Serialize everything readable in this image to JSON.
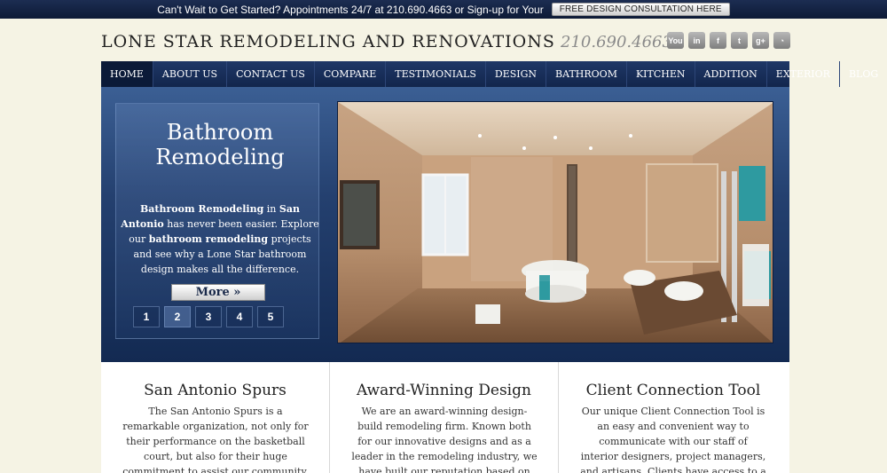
{
  "topbar": {
    "text": "Can't Wait to Get Started? Appointments 24/7 at 210.690.4663 or Sign-up for Your",
    "cta": "FREE DESIGN CONSULTATION HERE"
  },
  "header": {
    "brand": "LONE STAR REMODELING AND RENOVATIONS",
    "phone": "210.690.4663",
    "social": [
      {
        "name": "youtube-icon",
        "glyph": "You"
      },
      {
        "name": "linkedin-icon",
        "glyph": "in"
      },
      {
        "name": "facebook-icon",
        "glyph": "f"
      },
      {
        "name": "twitter-icon",
        "glyph": "t"
      },
      {
        "name": "googleplus-icon",
        "glyph": "g+"
      },
      {
        "name": "rss-icon",
        "glyph": "◔"
      }
    ]
  },
  "nav": {
    "items": [
      "HOME",
      "ABOUT US",
      "CONTACT US",
      "COMPARE",
      "TESTIMONIALS",
      "DESIGN",
      "BATHROOM",
      "KITCHEN",
      "ADDITION",
      "EXTERIOR",
      "BLOG"
    ],
    "active": "HOME"
  },
  "slider": {
    "title_line1": "Bathroom",
    "title_line2": "Remodeling",
    "text_b1": "Bathroom Remodeling",
    "text_1": " in ",
    "text_b2": "San Antonio",
    "text_2": " has never been easier. Explore our ",
    "text_b3": "bathroom remodeling",
    "text_3": " projects and see why a Lone Star bathroom design makes all the difference.",
    "more_label": "More »",
    "pages": [
      "1",
      "2",
      "3",
      "4",
      "5"
    ],
    "active_page": "2"
  },
  "columns": [
    {
      "title": "San Antonio Spurs",
      "text": "The San Antonio Spurs is a remarkable organization, not only for their performance on the basketball court, but also for their huge commitment to assist our community. We are proud to be an"
    },
    {
      "title": "Award-Winning Design",
      "text": "We are an award-winning design-build remodeling firm. Known both for our innovative designs and as a leader in the remodeling industry, we have built our reputation based on quality of"
    },
    {
      "title": "Client Connection Tool",
      "text": "Our unique Client Connection Tool is an easy and convenient way to communicate with our staff of interior designers, project managers, and artisans. Clients have access to a project"
    }
  ],
  "colors": {
    "navy": "#12264d",
    "cream": "#f5f3e4",
    "accent": "#3b5f94"
  }
}
